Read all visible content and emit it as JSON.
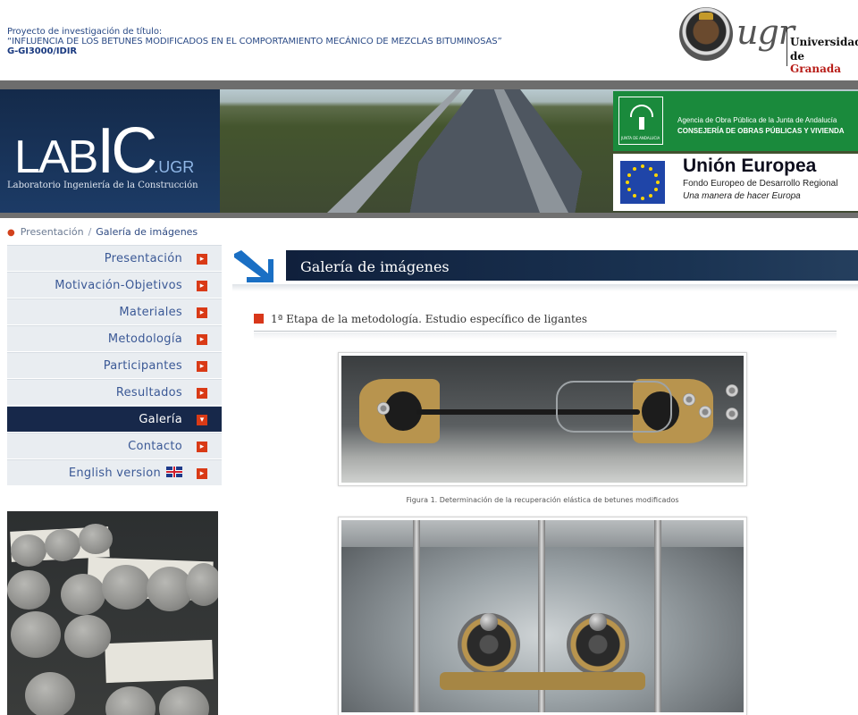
{
  "header": {
    "project_line1": "Proyecto de investigación de título:",
    "project_line2": "“INFLUENCIA DE LOS BETUNES MODIFICADOS EN EL COMPORTAMIENTO MECÁNICO DE MEZCLAS BITUMINOSAS”",
    "project_code": "G-GI3000/IDIR",
    "ugr_logo_text": "ugr",
    "ugr_name_line1": "Universidad",
    "ugr_name_line2_prefix": "de ",
    "ugr_name_line2_highlight": "Granada"
  },
  "banner": {
    "labic_letters": "LAB",
    "labic_big": "IC",
    "labic_suffix": ".UGR",
    "labic_subtitle": "Laboratorio Ingeniería de la Construcción",
    "junta_badge_text": "JUNTA DE ANDALUCIA",
    "junta_line1": "Agencia de Obra Pública de la Junta de Andalucía",
    "junta_line2": "CONSEJERÍA DE OBRAS PÚBLICAS Y VIVIENDA",
    "eu_title": "Unión Europea",
    "eu_line1": "Fondo Europeo de Desarrollo Regional",
    "eu_line2": "Una manera de hacer Europa"
  },
  "breadcrumb": {
    "home": "Presentación",
    "separator": "/",
    "current": "Galería de imágenes"
  },
  "sidebar": {
    "items": [
      {
        "label": "Presentación",
        "active": false
      },
      {
        "label": "Motivación-Objetivos",
        "active": false
      },
      {
        "label": "Materiales",
        "active": false
      },
      {
        "label": "Metodología",
        "active": false
      },
      {
        "label": "Participantes",
        "active": false
      },
      {
        "label": "Resultados",
        "active": false
      },
      {
        "label": "Galería",
        "active": true
      },
      {
        "label": "Contacto",
        "active": false
      },
      {
        "label": "English version",
        "active": false
      }
    ],
    "arrow_glyph": "▸",
    "active_arrow_glyph": "▾"
  },
  "main": {
    "section_title": "Galería de imágenes",
    "stage_title": "1ª Etapa de la metodología. Estudio específico de ligantes",
    "figure1_caption": "Figura 1. Determinación de la recuperación elástica de betunes modificados"
  },
  "colors": {
    "accent_red": "#d8371a",
    "nav_active_bg": "#17284a",
    "nav_text": "#3b5996",
    "header_text": "#2a4a86"
  },
  "icons": {
    "nav_arrow": "arrow-right-icon",
    "nav_arrow_active": "arrow-down-icon",
    "flag": "uk-flag-icon",
    "section": "arrow-down-right-icon"
  }
}
